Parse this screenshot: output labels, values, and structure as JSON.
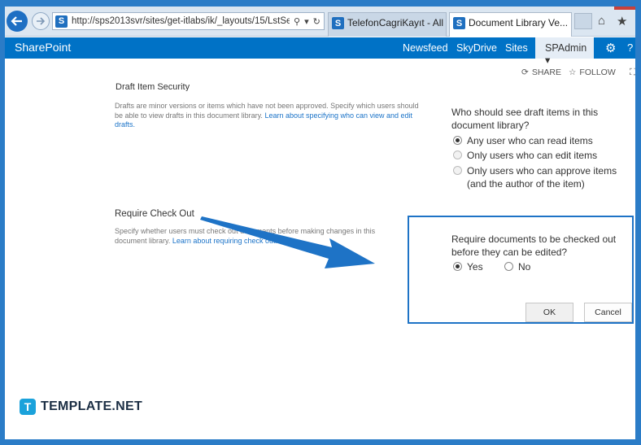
{
  "browser": {
    "url": "http://sps2013svr/sites/get-itlabs/ik/_layouts/15/LstSe",
    "tabs": [
      {
        "label": "TelefonCagriKayıt - All It..."
      },
      {
        "label": "Document Library Ve..."
      }
    ]
  },
  "suite_bar": {
    "brand": "SharePoint",
    "links": [
      "Newsfeed",
      "SkyDrive",
      "Sites"
    ],
    "user": "SPAdmin"
  },
  "page_actions": {
    "share": "SHARE",
    "follow": "FOLLOW"
  },
  "draft_security": {
    "title": "Draft Item Security",
    "description": "Drafts are minor versions or items which have not been approved. Specify which users should be able to view drafts in this document library.",
    "help_link": "Learn about specifying who can view and edit drafts.",
    "question": "Who should see draft items in this document library?",
    "options": [
      {
        "label": "Any user who can read items",
        "selected": true
      },
      {
        "label": "Only users who can edit items",
        "selected": false
      },
      {
        "label": "Only users who can approve items (and the author of the item)",
        "selected": false
      }
    ]
  },
  "require_checkout": {
    "title": "Require Check Out",
    "description": "Specify whether users must check out documents before making changes in this document library.",
    "help_link": "Learn about requiring check out.",
    "question": "Require documents to be checked out before they can be edited?",
    "options": [
      {
        "label": "Yes",
        "selected": true
      },
      {
        "label": "No",
        "selected": false
      }
    ]
  },
  "buttons": {
    "ok": "OK",
    "cancel": "Cancel"
  },
  "colors": {
    "suite_bar": "#0072c6",
    "annotation": "#1e73c6",
    "link": "#1b73c8"
  },
  "watermark": {
    "badge": "T",
    "text": "TEMPLATE.NET"
  }
}
